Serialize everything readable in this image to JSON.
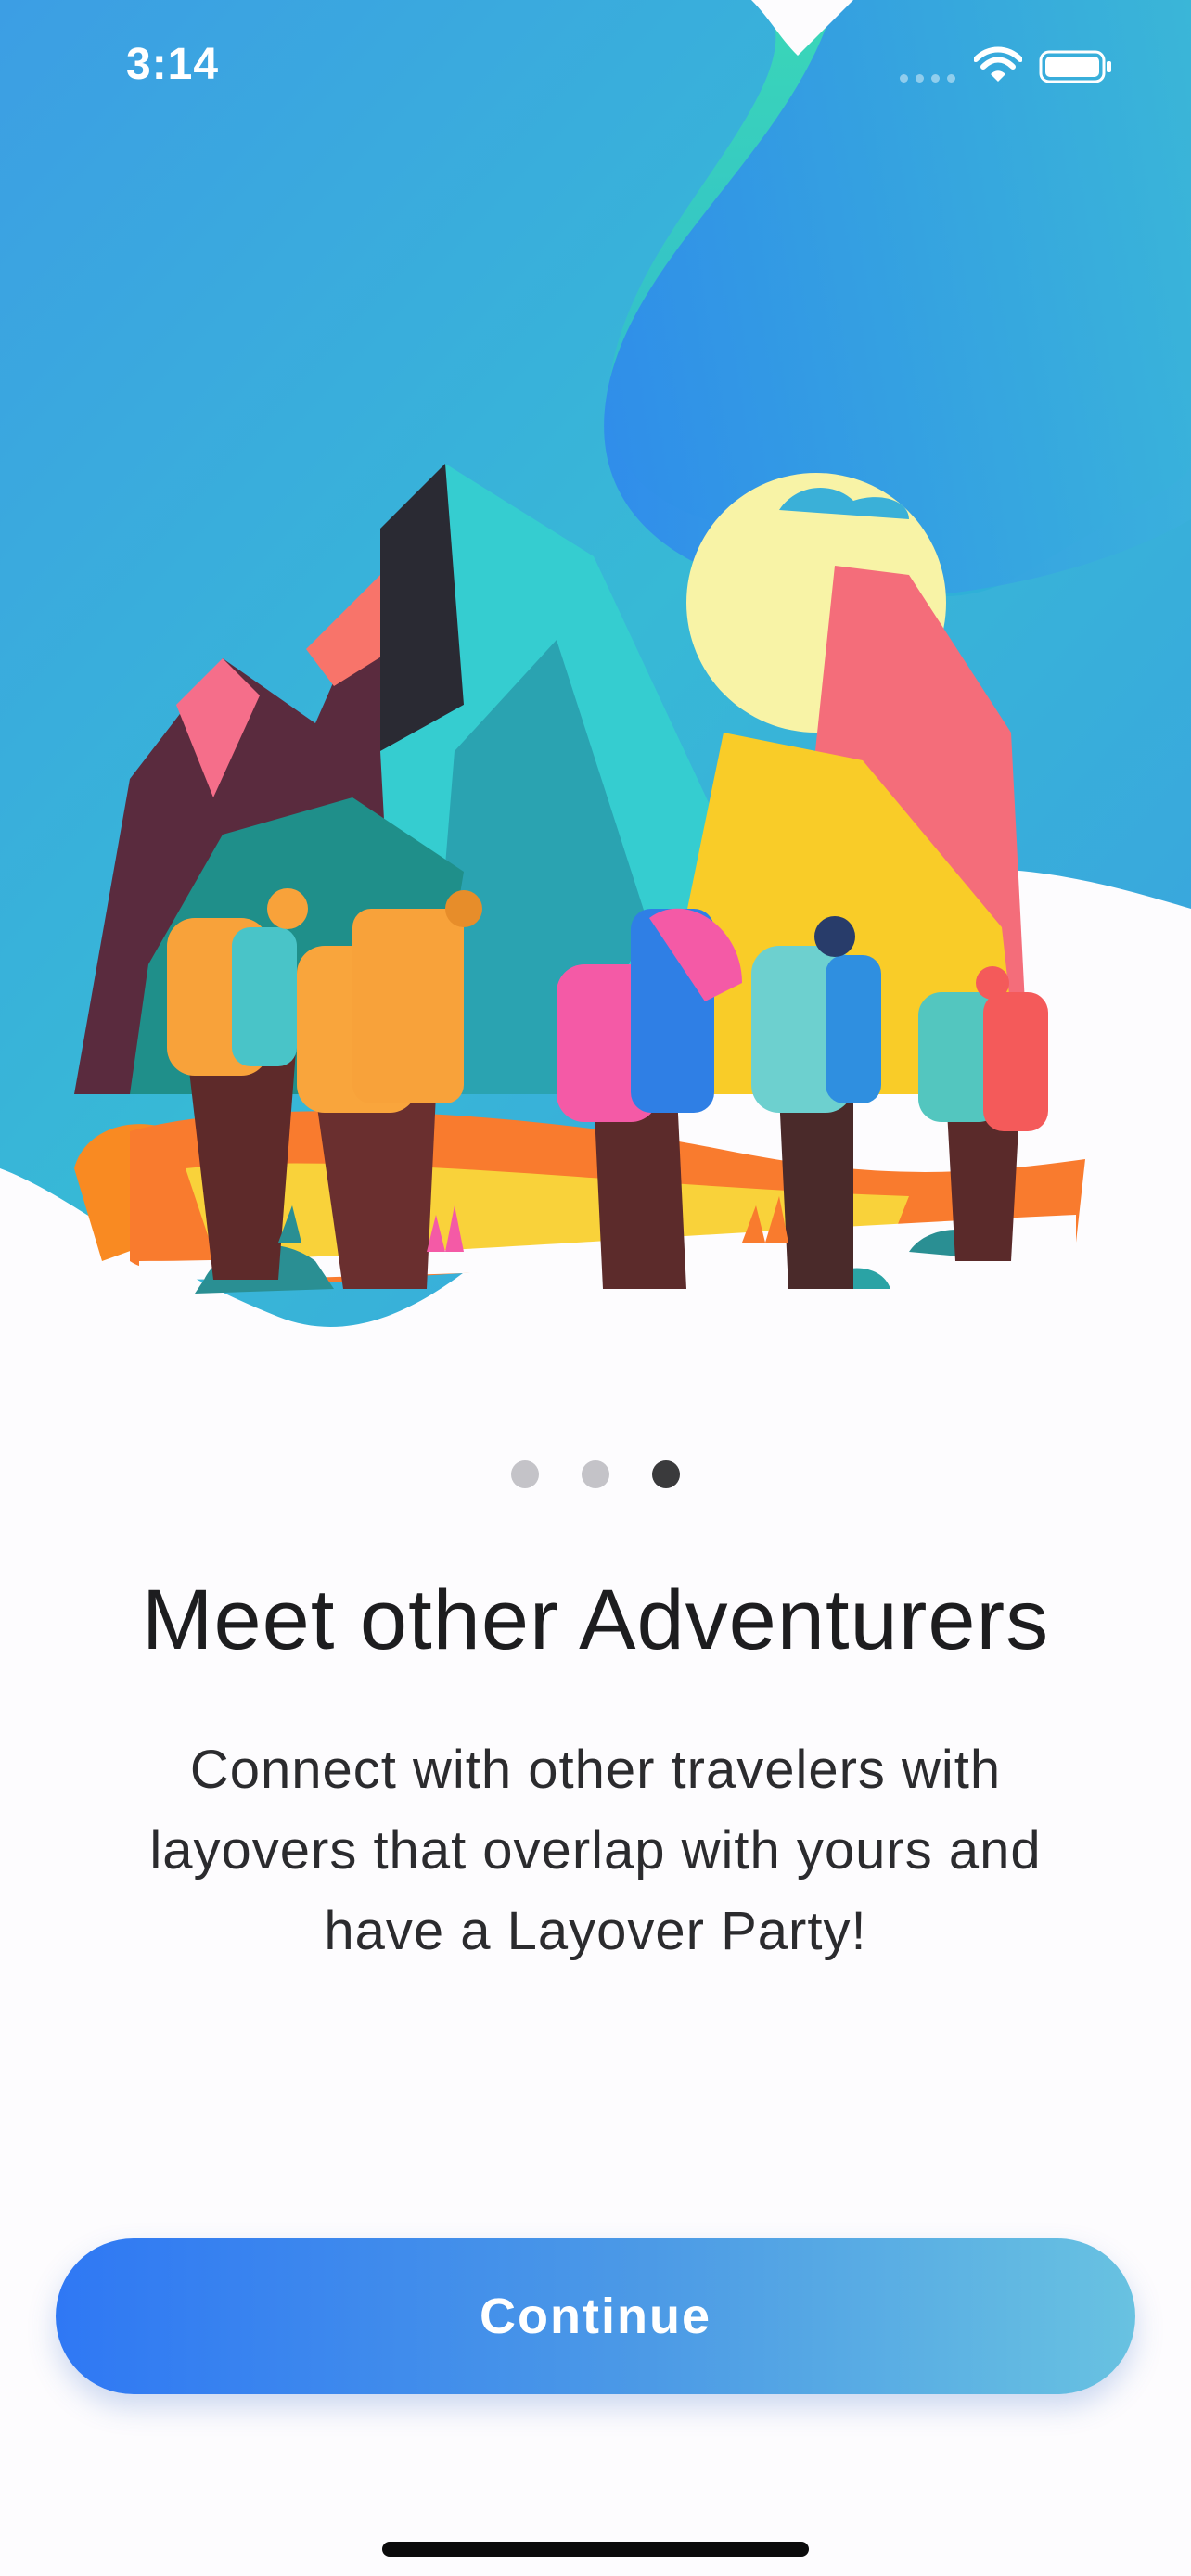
{
  "status_bar": {
    "time": "3:14",
    "wifi_icon": "wifi-icon",
    "battery_icon": "battery-icon",
    "signal_icon": "cellular-signal-icon"
  },
  "hero": {
    "image_subject": "colorful illustration of hikers with backpacks walking toward mountains",
    "colors": {
      "teal": "#35d0c0",
      "blue": "#3a8ee8",
      "pink": "#f45d9a",
      "orange": "#f8a62c",
      "yellow": "#f9d52a"
    }
  },
  "pagination": {
    "count": 3,
    "active_index": 2
  },
  "onboarding": {
    "title": "Meet other Adventurers",
    "description": "Connect with other travelers with layovers that overlap with yours and have a Layover Party!"
  },
  "continue_button": {
    "label": "Continue",
    "gradient_start": "#2f78f4",
    "gradient_end": "#68c2e1"
  }
}
